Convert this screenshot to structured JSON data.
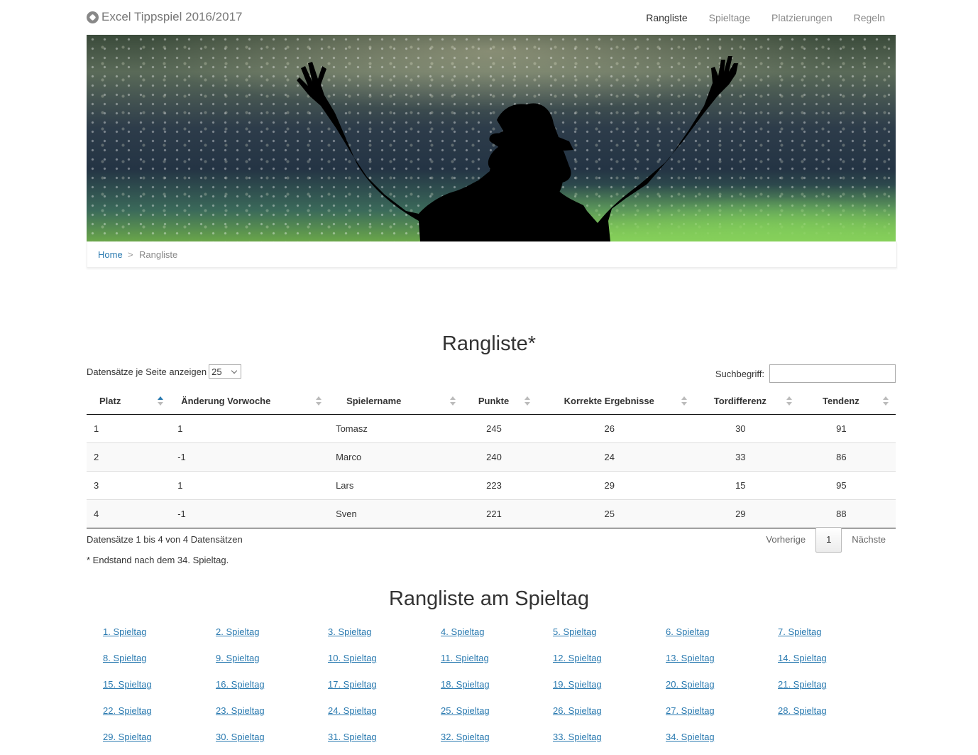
{
  "nav": {
    "brand": "Excel Tippspiel 2016/2017",
    "brand_icon": "soccer-ball-icon",
    "items": [
      "Rangliste",
      "Spieltage",
      "Platzierungen",
      "Regeln"
    ],
    "active": "Rangliste"
  },
  "breadcrumb": {
    "home": "Home",
    "separator": ">",
    "current": "Rangliste"
  },
  "ranking": {
    "title": "Rangliste*",
    "length_label": "Datensätze je Seite anzeigen",
    "length_value": "25",
    "search_label": "Suchbegriff:",
    "search_value": "",
    "columns": [
      "Platz",
      "Änderung Vorwoche",
      "Spielername",
      "Punkte",
      "Korrekte Ergebnisse",
      "Tordifferenz",
      "Tendenz"
    ],
    "rows": [
      [
        "1",
        "1",
        "Tomasz",
        "245",
        "26",
        "30",
        "91"
      ],
      [
        "2",
        "-1",
        "Marco",
        "240",
        "24",
        "33",
        "86"
      ],
      [
        "3",
        "1",
        "Lars",
        "223",
        "29",
        "15",
        "95"
      ],
      [
        "4",
        "-1",
        "Sven",
        "221",
        "25",
        "29",
        "88"
      ]
    ],
    "info": "Datensätze 1 bis 4 von 4 Datensätzen",
    "prev": "Vorherige",
    "page": "1",
    "next": "Nächste",
    "footnote": "* Endstand nach dem 34. Spieltag."
  },
  "matchdays": {
    "title": "Rangliste am Spieltag",
    "links": [
      "1. Spieltag",
      "2. Spieltag",
      "3. Spieltag",
      "4. Spieltag",
      "5. Spieltag",
      "6. Spieltag",
      "7. Spieltag",
      "8. Spieltag",
      "9. Spieltag",
      "10. Spieltag",
      "11. Spieltag",
      "12. Spieltag",
      "13. Spieltag",
      "14. Spieltag",
      "15. Spieltag",
      "16. Spieltag",
      "17. Spieltag",
      "18. Spieltag",
      "19. Spieltag",
      "20. Spieltag",
      "21. Spieltag",
      "22. Spieltag",
      "23. Spieltag",
      "24. Spieltag",
      "25. Spieltag",
      "26. Spieltag",
      "27. Spieltag",
      "28. Spieltag",
      "29. Spieltag",
      "30. Spieltag",
      "31. Spieltag",
      "32. Spieltag",
      "33. Spieltag",
      "34. Spieltag"
    ]
  },
  "colors": {
    "link": "#2a7ab0",
    "nav_text": "#888888",
    "sort_active": "#2a7ab0"
  }
}
